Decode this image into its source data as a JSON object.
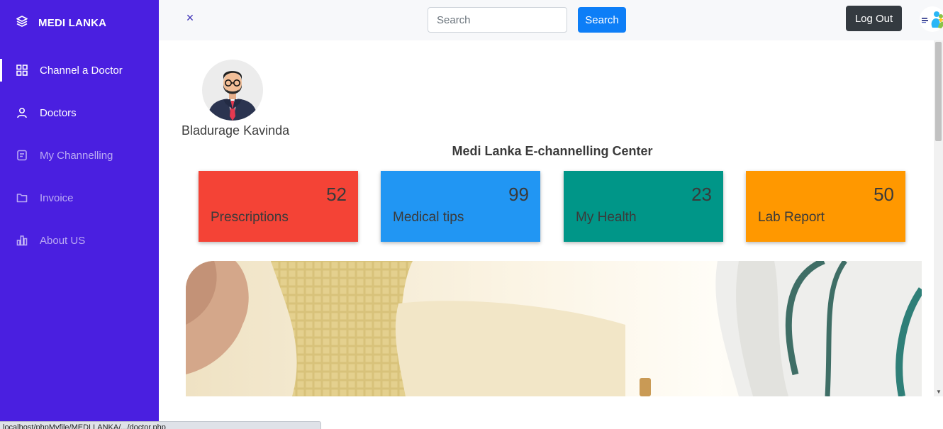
{
  "sidebar": {
    "brand": {
      "name": "MEDI LANKA",
      "icon": "layers-icon"
    },
    "items": [
      {
        "label": "Channel a Doctor",
        "icon": "grid-icon",
        "state": "active"
      },
      {
        "label": "Doctors",
        "icon": "user-icon",
        "state": "normal"
      },
      {
        "label": "My Channelling",
        "icon": "document-icon",
        "state": "dim"
      },
      {
        "label": "Invoice",
        "icon": "folder-icon",
        "state": "dim"
      },
      {
        "label": "About US",
        "icon": "bar-chart-icon",
        "state": "dim"
      }
    ]
  },
  "topbar": {
    "close_icon": "×",
    "search": {
      "placeholder": "Search",
      "value": "",
      "button_label": "Search"
    },
    "logout_label": "Log Out"
  },
  "main": {
    "user_name": "Bladurage Kavinda",
    "title": "Medi Lanka E-channelling Center",
    "cards": [
      {
        "label": "Prescriptions",
        "value": "52",
        "color": "#f44336"
      },
      {
        "label": "Medical tips",
        "value": "99",
        "color": "#2196f3"
      },
      {
        "label": "My Health",
        "value": "23",
        "color": "#009688"
      },
      {
        "label": "Lab Report",
        "value": "50",
        "color": "#ff9800"
      }
    ]
  },
  "status_bar": {
    "text": "localhost/phpMyfile/MEDI LANKA/.../doctor.php"
  },
  "colors": {
    "sidebar_bg": "#4a1fe0",
    "search_button": "#0d7ef7",
    "logout_button": "#343a40"
  }
}
